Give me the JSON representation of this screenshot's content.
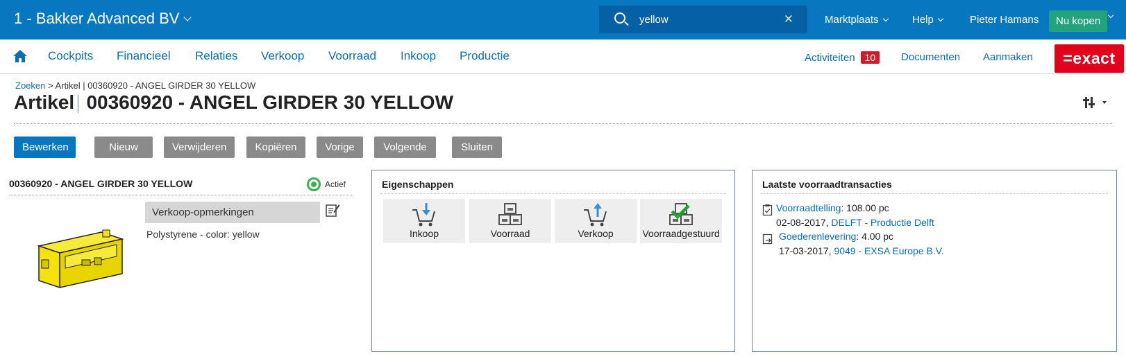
{
  "topbar": {
    "company": "1 - Bakker Advanced BV",
    "search_value": "yellow",
    "marketplace": "Marktplaats",
    "help": "Help",
    "user": "Pieter Hamans",
    "buy_label": "Nu kopen"
  },
  "nav": {
    "items": [
      "Cockpits",
      "Financieel",
      "Relaties",
      "Verkoop",
      "Voorraad",
      "Inkoop",
      "Productie"
    ],
    "activities": "Activiteiten",
    "activities_count": "10",
    "documents": "Documenten",
    "create": "Aanmaken",
    "brand": "=exact"
  },
  "header": {
    "breadcrumb_link": "Zoeken",
    "breadcrumb_rest": " > Artikel | 00360920 - ANGEL GIRDER 30 YELLOW",
    "title_type": "Artikel",
    "title_separator": "|",
    "title_name": "00360920 - ANGEL GIRDER 30 YELLOW"
  },
  "toolbar": {
    "edit": "Bewerken",
    "new": "Nieuw",
    "delete": "Verwijderen",
    "copy": "Kopiëren",
    "previous": "Vorige",
    "next": "Volgende",
    "close": "Sluiten"
  },
  "article": {
    "title": "00360920 - ANGEL GIRDER 30 YELLOW",
    "status": "Actief",
    "remarks_label": "Verkoop-opmerkingen",
    "remarks_text": "Polystyrene - color: yellow"
  },
  "properties": {
    "title": "Eigenschappen",
    "tiles": [
      "Inkoop",
      "Voorraad",
      "Verkoop",
      "Voorraadgestuurd"
    ]
  },
  "transactions": {
    "title": "Laatste voorraadtransacties",
    "items": [
      {
        "type": "Voorraadtelling",
        "amount": ": 108.00 pc",
        "date": "02-08-2017, ",
        "party": "DELFT - Productie Delft"
      },
      {
        "type": "Goederenlevering",
        "amount": ": 4.00 pc",
        "date": "17-03-2017, ",
        "party": "9049 - EXSA Europe B.V."
      }
    ]
  },
  "colors": {
    "brand_blue": "#0778bf",
    "buy_green": "#22a27d",
    "exact_red": "#e2001a",
    "badge_red": "#cc1e2b",
    "status_green": "#36b34a",
    "product_yellow": "#f4e20a"
  }
}
